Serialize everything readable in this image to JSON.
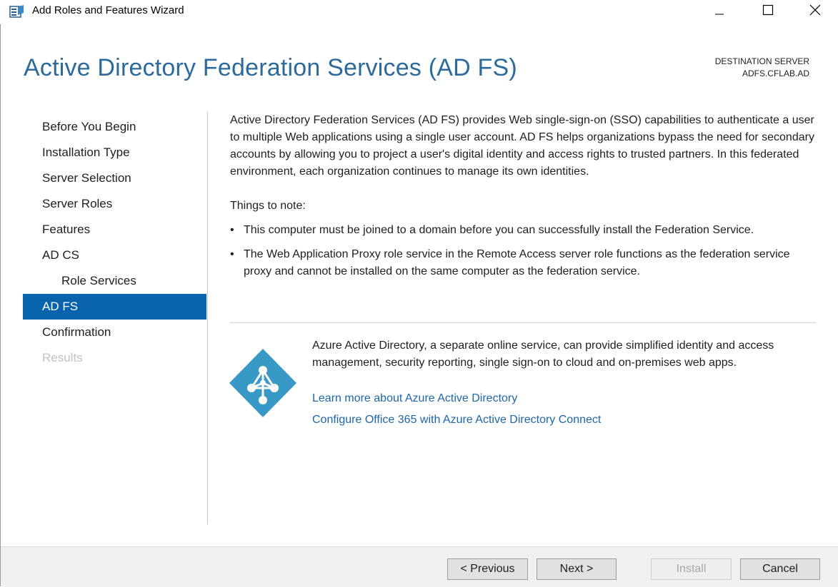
{
  "window": {
    "title": "Add Roles and Features Wizard"
  },
  "header": {
    "page_title": "Active Directory Federation Services (AD FS)",
    "destination_label": "DESTINATION SERVER",
    "destination_server": "ADFS.CFLAB.AD"
  },
  "nav": {
    "items": [
      {
        "label": "Before You Begin",
        "state": "normal"
      },
      {
        "label": "Installation Type",
        "state": "normal"
      },
      {
        "label": "Server Selection",
        "state": "normal"
      },
      {
        "label": "Server Roles",
        "state": "normal"
      },
      {
        "label": "Features",
        "state": "normal"
      },
      {
        "label": "AD CS",
        "state": "normal"
      },
      {
        "label": "Role Services",
        "state": "sub"
      },
      {
        "label": "AD FS",
        "state": "active"
      },
      {
        "label": "Confirmation",
        "state": "normal"
      },
      {
        "label": "Results",
        "state": "disabled"
      }
    ]
  },
  "content": {
    "intro": "Active Directory Federation Services (AD FS) provides Web single-sign-on (SSO) capabilities to authenticate a user to multiple Web applications using a single user account. AD FS helps organizations bypass the need for secondary accounts by allowing you to project a user's digital identity and access rights to trusted partners. In this federated environment, each organization continues to manage its own identities.",
    "notes_heading": "Things to note:",
    "bullet_char": "•",
    "notes": [
      "This computer must be joined to a domain before you can successfully install the Federation Service.",
      "The Web Application Proxy role service in the Remote Access server role functions as the federation service proxy and cannot be installed on the same computer as the federation service."
    ]
  },
  "azure": {
    "icon": "azure-active-directory-icon",
    "description": "Azure Active Directory, a separate online service, can provide simplified identity and access management, security reporting, single sign-on to cloud and on-premises web apps.",
    "link_learn_more": "Learn more about Azure Active Directory",
    "link_configure": "Configure Office 365 with Azure Active Directory Connect"
  },
  "footer": {
    "previous_label": "< Previous",
    "next_label": "Next >",
    "install_label": "Install",
    "cancel_label": "Cancel"
  },
  "colors": {
    "title_blue": "#2c6a9b",
    "nav_active": "#0a64ad",
    "link_blue": "#1f66a8",
    "azure_blue": "#3999c6"
  }
}
